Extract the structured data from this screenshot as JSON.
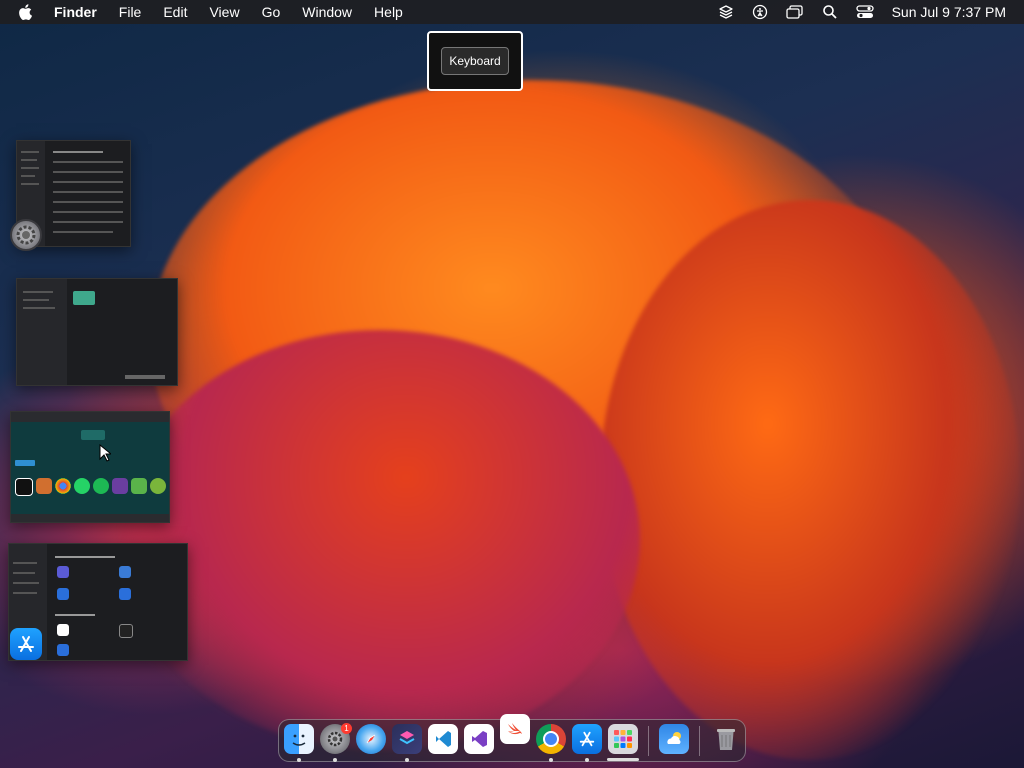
{
  "menubar": {
    "app_name": "Finder",
    "menus": [
      "File",
      "Edit",
      "View",
      "Go",
      "Window",
      "Help"
    ],
    "clock": "Sun Jul 9  7:37 PM",
    "status_icons": [
      "layers-icon",
      "accessibility-icon",
      "display-icon",
      "search-icon",
      "control-center-icon"
    ]
  },
  "hud": {
    "label": "Keyboard"
  },
  "stage_manager": {
    "groups": [
      "system-settings-window",
      "dark-app-window",
      "app-store-browser-window",
      "app-store-window"
    ],
    "app_icons": [
      "system-settings-icon",
      "app-store-icon"
    ]
  },
  "dock": {
    "apps": [
      "Finder",
      "System Settings",
      "Safari",
      "Shortcuts",
      "Visual Studio Code",
      "Visual Studio",
      "Swift Playgrounds",
      "Google Chrome",
      "App Store",
      "Launchpad",
      "Weather",
      "Trash"
    ],
    "badges": {
      "system_settings": "1"
    }
  },
  "colors": {
    "menubar_bg": "#1e1e22",
    "accent": "#0a84ff"
  }
}
